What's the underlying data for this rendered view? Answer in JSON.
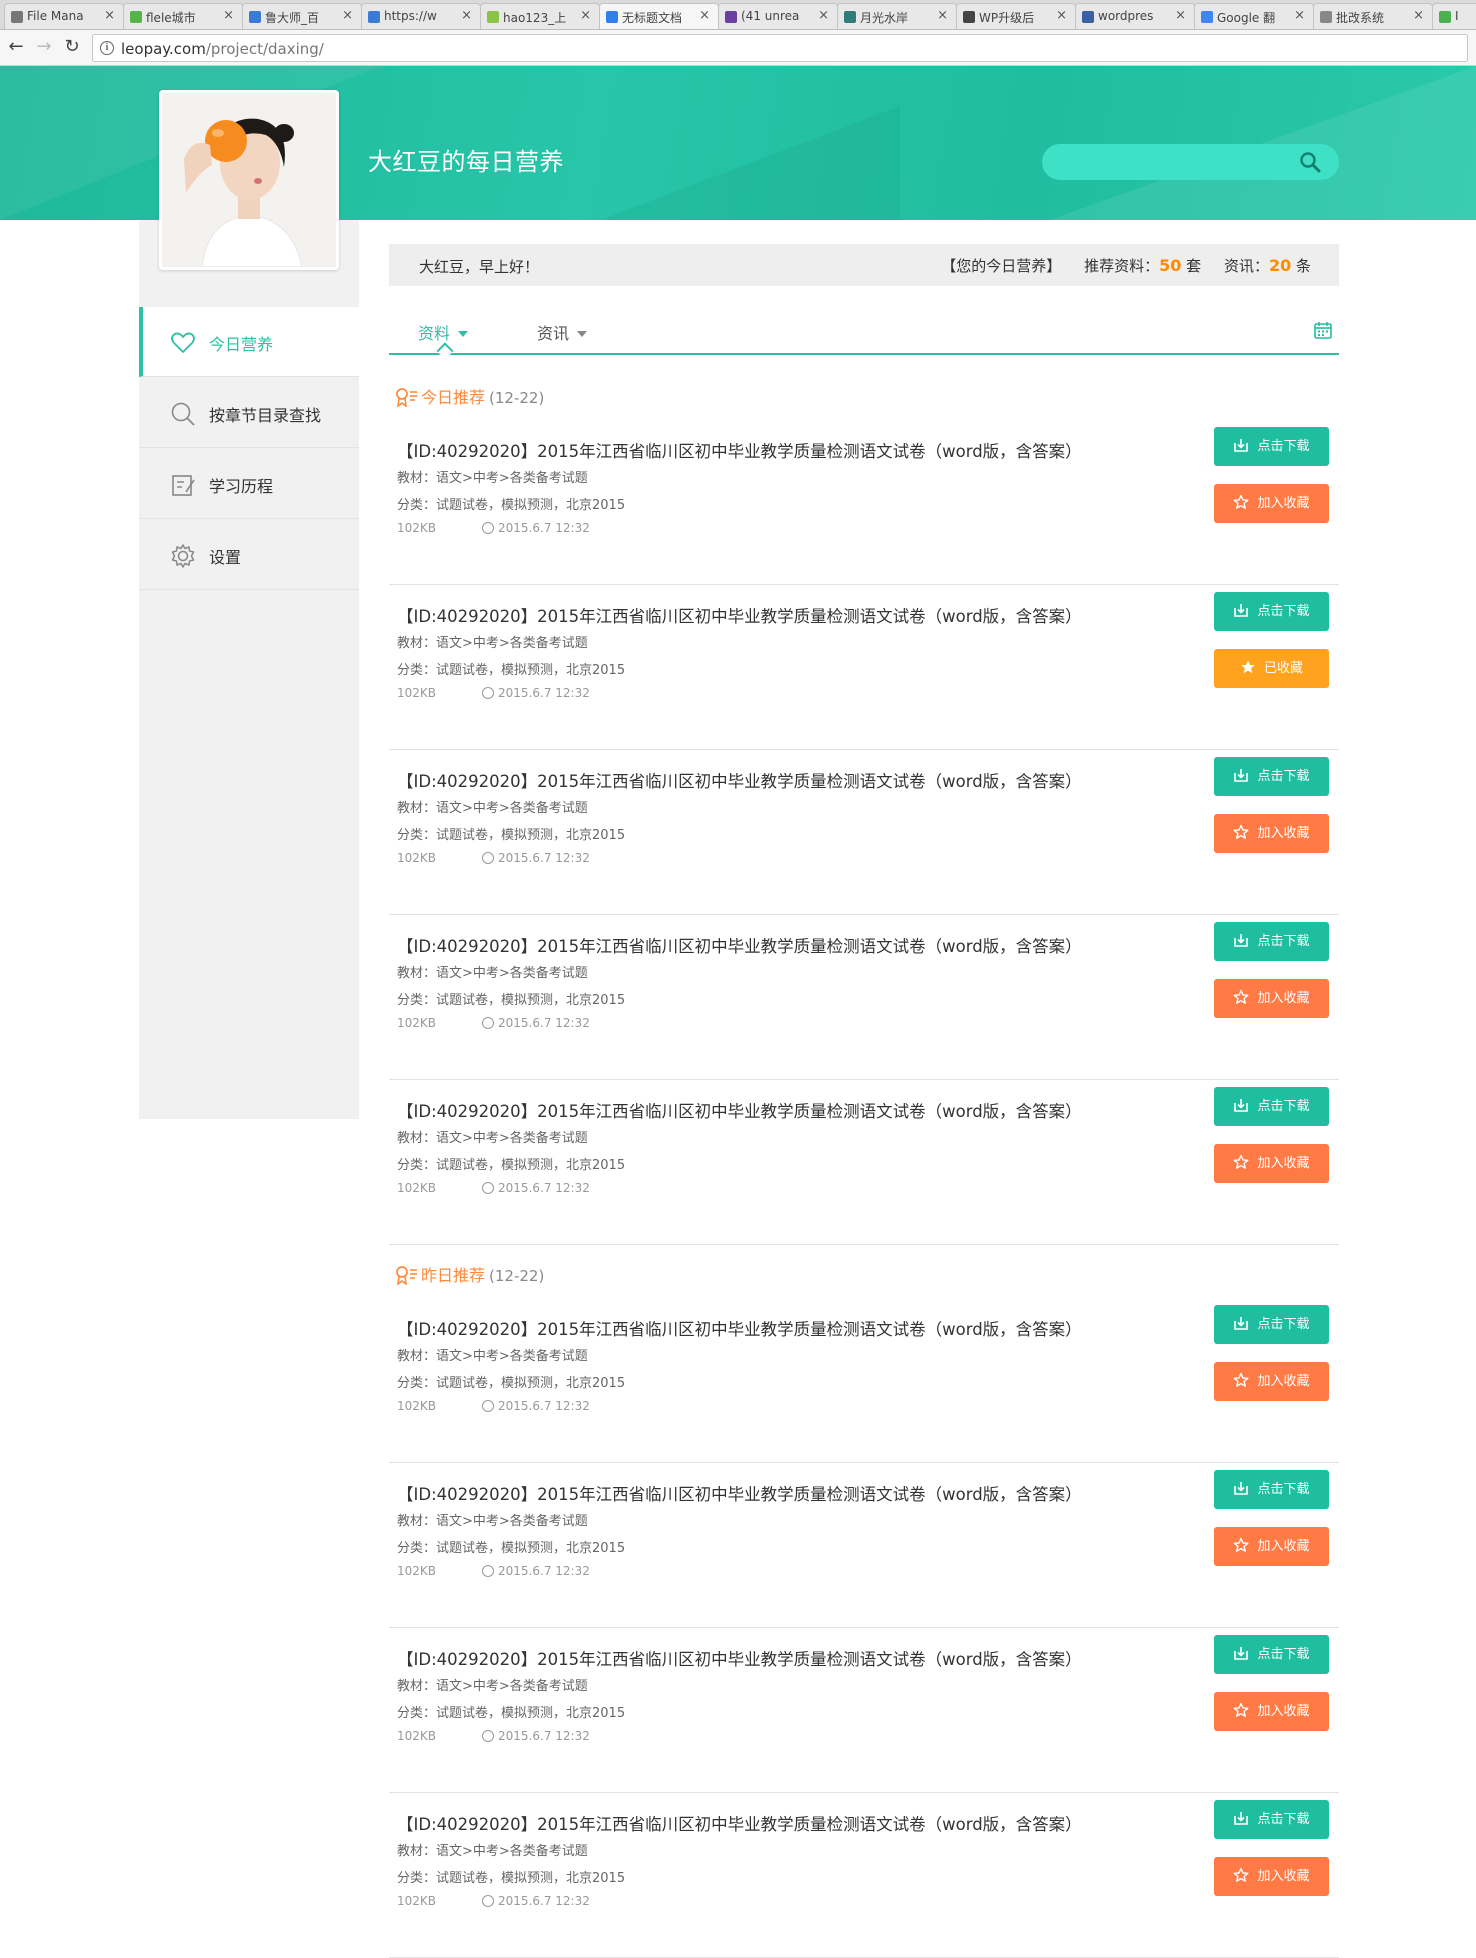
{
  "browser": {
    "tabs": [
      {
        "label": "File Mana",
        "color": "#777777",
        "active": false
      },
      {
        "label": "flele城市",
        "color": "#55b44a",
        "active": false
      },
      {
        "label": "鲁大师_百",
        "color": "#3a7bd5",
        "active": false
      },
      {
        "label": "https://w",
        "color": "#3a7bd5",
        "active": false
      },
      {
        "label": "hao123_上",
        "color": "#8bc34a",
        "active": false
      },
      {
        "label": "无标题文档",
        "color": "#2f80ed",
        "active": true
      },
      {
        "label": "(41 unrea",
        "color": "#6a3fa0",
        "active": false
      },
      {
        "label": "月光水岸",
        "color": "#2e7d7b",
        "active": false
      },
      {
        "label": "WP升级后",
        "color": "#444444",
        "active": false
      },
      {
        "label": "wordpres",
        "color": "#3b5fa3",
        "active": false
      },
      {
        "label": "Google 翻",
        "color": "#4285f4",
        "active": false
      },
      {
        "label": "批改系统",
        "color": "#888888",
        "active": false
      },
      {
        "label": "I",
        "color": "#4caf50",
        "active": false
      }
    ],
    "url_host": "leopay.com",
    "url_path": "/project/daxing/"
  },
  "header": {
    "site_title": "大红豆的每日营养",
    "search_placeholder": ""
  },
  "sidebar": {
    "items": [
      {
        "label": "今日营养",
        "icon": "heart-icon",
        "active": true
      },
      {
        "label": "按章节目录查找",
        "icon": "search-icon",
        "active": false
      },
      {
        "label": "学习历程",
        "icon": "notes-icon",
        "active": false
      },
      {
        "label": "设置",
        "icon": "gear-icon",
        "active": false
      }
    ]
  },
  "greeting": {
    "hello": "大红豆，早上好！",
    "today_label": "【您的今日营养】",
    "rec_label": "推荐资料：",
    "rec_count": "50",
    "rec_unit": " 套",
    "news_label": "资讯：",
    "news_count": "20",
    "news_unit": " 条"
  },
  "content_tabs": [
    {
      "label": "资料",
      "active": true
    },
    {
      "label": "资讯",
      "active": false
    }
  ],
  "sections": [
    {
      "title": "今日推荐",
      "date": "(12-22)"
    },
    {
      "title": "昨日推荐",
      "date": "(12-22)"
    }
  ],
  "items": [
    {
      "title": "【ID:40292020】2015年江西省临川区初中毕业教学质量检测语文试卷（word版，含答案）",
      "textbook": "教材：语文>中考>各类备考试题",
      "category": "分类：试题试卷，模拟预测，北京2015",
      "size": "102KB",
      "time": "2015.6.7 12:32",
      "download_label": "点击下载",
      "fav_label": "加入收藏",
      "favorited": false
    },
    {
      "title": "【ID:40292020】2015年江西省临川区初中毕业教学质量检测语文试卷（word版，含答案）",
      "textbook": "教材：语文>中考>各类备考试题",
      "category": "分类：试题试卷，模拟预测，北京2015",
      "size": "102KB",
      "time": "2015.6.7 12:32",
      "download_label": "点击下载",
      "fav_label": "已收藏",
      "favorited": true
    },
    {
      "title": "【ID:40292020】2015年江西省临川区初中毕业教学质量检测语文试卷（word版，含答案）",
      "textbook": "教材：语文>中考>各类备考试题",
      "category": "分类：试题试卷，模拟预测，北京2015",
      "size": "102KB",
      "time": "2015.6.7 12:32",
      "download_label": "点击下载",
      "fav_label": "加入收藏",
      "favorited": false
    },
    {
      "title": "【ID:40292020】2015年江西省临川区初中毕业教学质量检测语文试卷（word版，含答案）",
      "textbook": "教材：语文>中考>各类备考试题",
      "category": "分类：试题试卷，模拟预测，北京2015",
      "size": "102KB",
      "time": "2015.6.7 12:32",
      "download_label": "点击下载",
      "fav_label": "加入收藏",
      "favorited": false
    },
    {
      "title": "【ID:40292020】2015年江西省临川区初中毕业教学质量检测语文试卷（word版，含答案）",
      "textbook": "教材：语文>中考>各类备考试题",
      "category": "分类：试题试卷，模拟预测，北京2015",
      "size": "102KB",
      "time": "2015.6.7 12:32",
      "download_label": "点击下载",
      "fav_label": "加入收藏",
      "favorited": false
    },
    {
      "title": "【ID:40292020】2015年江西省临川区初中毕业教学质量检测语文试卷（word版，含答案）",
      "textbook": "教材：语文>中考>各类备考试题",
      "category": "分类：试题试卷，模拟预测，北京2015",
      "size": "102KB",
      "time": "2015.6.7 12:32",
      "download_label": "点击下载",
      "fav_label": "加入收藏",
      "favorited": false
    },
    {
      "title": "【ID:40292020】2015年江西省临川区初中毕业教学质量检测语文试卷（word版，含答案）",
      "textbook": "教材：语文>中考>各类备考试题",
      "category": "分类：试题试卷，模拟预测，北京2015",
      "size": "102KB",
      "time": "2015.6.7 12:32",
      "download_label": "点击下载",
      "fav_label": "加入收藏",
      "favorited": false
    },
    {
      "title": "【ID:40292020】2015年江西省临川区初中毕业教学质量检测语文试卷（word版，含答案）",
      "textbook": "教材：语文>中考>各类备考试题",
      "category": "分类：试题试卷，模拟预测，北京2015",
      "size": "102KB",
      "time": "2015.6.7 12:32",
      "download_label": "点击下载",
      "fav_label": "加入收藏",
      "favorited": false
    },
    {
      "title": "【ID:40292020】2015年江西省临川区初中毕业教学质量检测语文试卷（word版，含答案）",
      "textbook": "教材：语文>中考>各类备考试题",
      "category": "分类：试题试卷，模拟预测，北京2015",
      "size": "102KB",
      "time": "2015.6.7 12:32",
      "download_label": "点击下载",
      "fav_label": "加入收藏",
      "favorited": false
    }
  ],
  "colors": {
    "brand": "#1fbea0",
    "accent_orange": "#ff7a45",
    "favorited_orange": "#ffa21e",
    "count_orange": "#ff8a00"
  }
}
